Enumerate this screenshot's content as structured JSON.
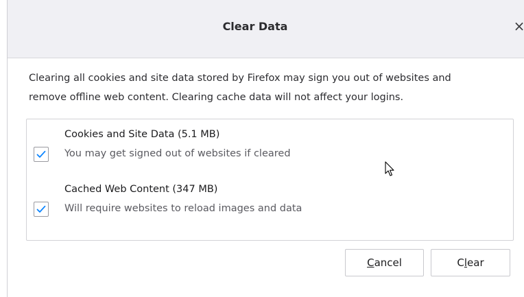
{
  "dialog": {
    "title": "Clear Data",
    "close_glyph": "×",
    "description_line1": "Clearing all cookies and site data stored by Firefox may sign you out of websites and",
    "description_line2": "remove offline web content. Clearing cache data will not affect your logins.",
    "options": [
      {
        "label": "Cookies and Site Data (5.1 MB)",
        "sublabel": "You may get signed out of websites if cleared",
        "checked": true
      },
      {
        "label": "Cached Web Content (347 MB)",
        "sublabel": "Will require websites to reload images and data",
        "checked": true
      }
    ],
    "buttons": {
      "cancel_accesskey": "C",
      "cancel_rest": "ancel",
      "clear_pre": "C",
      "clear_accesskey": "l",
      "clear_rest": "ear"
    }
  },
  "colors": {
    "checkmark": "#0a84ff",
    "titlebar": "#f0f0f4"
  },
  "icons": {
    "close": "close-icon",
    "check": "checkmark-icon",
    "cursor": "mouse-pointer-icon"
  }
}
